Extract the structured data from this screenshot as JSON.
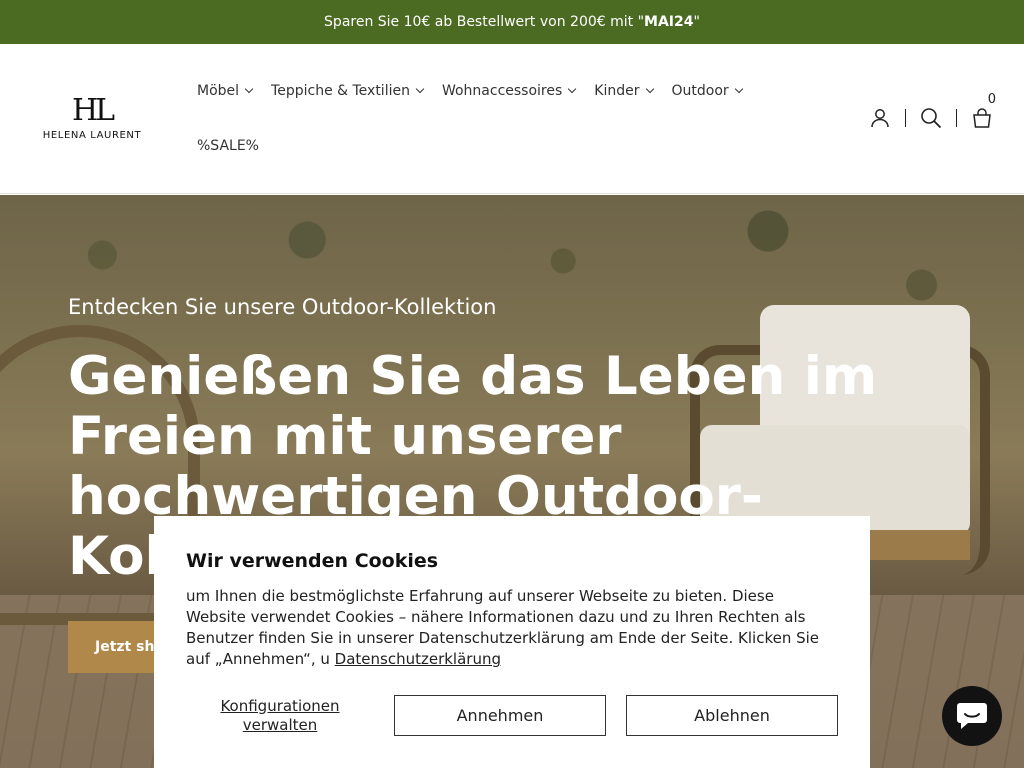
{
  "announcement": {
    "prefix": "Sparen Sie 10€ ab Bestellwert von 200€ mit \"",
    "code": "MAI24",
    "suffix": " \""
  },
  "logo": {
    "mark": "HL",
    "text": "HELENA LAURENT"
  },
  "nav": {
    "items": [
      {
        "label": "Möbel",
        "has_dropdown": true
      },
      {
        "label": "Teppiche & Textilien",
        "has_dropdown": true
      },
      {
        "label": "Wohnaccessoires",
        "has_dropdown": true
      },
      {
        "label": "Kinder",
        "has_dropdown": true
      },
      {
        "label": "Outdoor",
        "has_dropdown": true
      },
      {
        "label": "%SALE%",
        "has_dropdown": false
      }
    ]
  },
  "header_icons": {
    "account": "user-icon",
    "search": "search-icon",
    "cart": "bag-icon",
    "cart_count": "0"
  },
  "hero": {
    "subtitle": "Entdecken Sie unsere Outdoor-Kollektion",
    "title": "Genießen Sie das Leben im Freien mit unserer hochwertigen Outdoor-Kollektion",
    "button_label": "Jetzt shoppen"
  },
  "cookie": {
    "title": "Wir verwenden Cookies",
    "text": "um Ihnen die bestmöglichste Erfahrung auf unserer Webseite zu bieten. Diese Website verwendet Cookies – nähere Informationen dazu und zu Ihren Rechten als Benutzer finden Sie in unserer Datenschutzerklärung am Ende der Seite. Klicken Sie auf „Annehmen“, u ",
    "link": "Datenschutzerklärung",
    "configure_label": "Konfigurationen verwalten",
    "accept_label": "Annehmen",
    "decline_label": "Ablehnen"
  },
  "chat": {
    "icon": "chat-icon"
  },
  "colors": {
    "announce_bg": "#4a6b21",
    "cta": "#b0894a",
    "chat_bg": "#121212"
  }
}
